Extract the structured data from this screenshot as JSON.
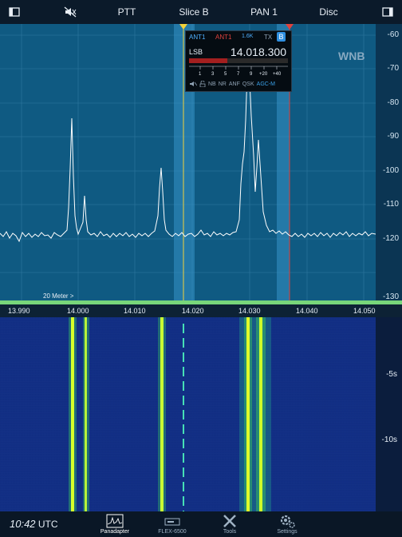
{
  "topbar": {
    "ptt_label": "PTT",
    "slice_label": "Slice B",
    "pan_label": "PAN 1",
    "disc_label": "Disc"
  },
  "panadapter": {
    "db_scale": [
      "-60",
      "-70",
      "-80",
      "-90",
      "-100",
      "-110",
      "-120",
      "-130"
    ],
    "wnb_label": "WNB",
    "band_label": "20 Meter >"
  },
  "freq_axis": {
    "ticks": [
      "13.990",
      "14.000",
      "14.010",
      "14.020",
      "14.030",
      "14.040",
      "14.050"
    ]
  },
  "slice": {
    "ant_rx": "ANT1",
    "ant_tx": "ANT1",
    "filter": "1.6K",
    "tx": "TX",
    "letter": "B",
    "mode": "LSB",
    "frequency": "14.018.300",
    "s_meter_scale": [
      "1",
      "3",
      "5",
      "7",
      "9",
      "+20",
      "+40"
    ],
    "dsp": [
      "NB",
      "NR",
      "ANF",
      "QSK",
      "AGC-M"
    ]
  },
  "waterfall": {
    "time_labels": [
      "-5s",
      "-10s"
    ]
  },
  "bottombar": {
    "time": "10:42",
    "timezone": "UTC",
    "tabs": [
      "Panadapter",
      "FLEX-6500",
      "Tools",
      "Settings"
    ]
  },
  "colors": {
    "accent_yellow": "#f2d23a",
    "accent_red": "#e0423d",
    "band_green": "#78d67a",
    "agc_blue": "#3aa0e8"
  }
}
